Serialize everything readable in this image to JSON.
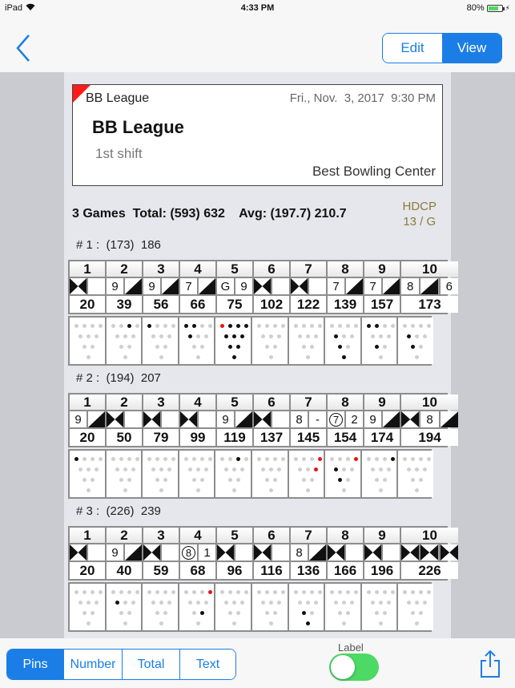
{
  "status_bar": {
    "device": "iPad",
    "time": "4:33 PM",
    "battery": "80%",
    "battery_level": 0.8
  },
  "nav": {
    "back_icon": "chevron-left-icon",
    "segments": [
      {
        "label": "Edit",
        "active": false
      },
      {
        "label": "View",
        "active": true
      }
    ]
  },
  "header": {
    "league_small": "BB League",
    "datetime": "Fri., Nov.  3, 2017  9:30 PM",
    "title": "BB League",
    "subtitle": "1st shift",
    "center": "Best Bowling Center",
    "corner_color": "#ff1a1a"
  },
  "summary": {
    "text": "3 Games  Total: (593) 632    Avg: (197.7) 210.7",
    "hdcp_label": "HDCP",
    "hdcp_value": "13 / G"
  },
  "games": [
    {
      "label": "# 1 :  (173)  186",
      "frames": [
        {
          "num": "1",
          "balls": [
            "X",
            ""
          ],
          "total": "20",
          "pins": {}
        },
        {
          "num": "2",
          "balls": [
            "9",
            "/"
          ],
          "total": "39",
          "pins": {
            "9": "black"
          }
        },
        {
          "num": "3",
          "balls": [
            "9",
            "/"
          ],
          "total": "56",
          "pins": {
            "7": "black"
          }
        },
        {
          "num": "4",
          "balls": [
            "7",
            "/"
          ],
          "total": "66",
          "pins": {
            "7": "black",
            "8": "black",
            "4": "black"
          }
        },
        {
          "num": "5",
          "balls": [
            "G",
            "9"
          ],
          "total": "75",
          "pins": {
            "7": "red",
            "8": "black",
            "9": "black",
            "10": "black",
            "4": "black",
            "5": "black",
            "6": "black",
            "2": "black",
            "3": "black",
            "1": "black"
          }
        },
        {
          "num": "6",
          "balls": [
            "X",
            ""
          ],
          "total": "102",
          "pins": {}
        },
        {
          "num": "7",
          "balls": [
            "X",
            ""
          ],
          "total": "122",
          "pins": {}
        },
        {
          "num": "8",
          "balls": [
            "7",
            "/"
          ],
          "total": "139",
          "pins": {
            "4": "black",
            "2": "black",
            "1": "black"
          }
        },
        {
          "num": "9",
          "balls": [
            "7",
            "/"
          ],
          "total": "157",
          "pins": {
            "7": "black",
            "8": "black",
            "2": "black"
          }
        },
        {
          "num": "10",
          "balls": [
            "8",
            "/",
            "6"
          ],
          "total": "173",
          "pins": {
            "4": "black",
            "2": "black"
          }
        }
      ]
    },
    {
      "label": "# 2 :  (194)  207",
      "frames": [
        {
          "num": "1",
          "balls": [
            "9",
            "/"
          ],
          "total": "20",
          "pins": {
            "7": "black"
          }
        },
        {
          "num": "2",
          "balls": [
            "X",
            ""
          ],
          "total": "50",
          "pins": {}
        },
        {
          "num": "3",
          "balls": [
            "X",
            ""
          ],
          "total": "79",
          "pins": {}
        },
        {
          "num": "4",
          "balls": [
            "X",
            ""
          ],
          "total": "99",
          "pins": {}
        },
        {
          "num": "5",
          "balls": [
            "9",
            "/"
          ],
          "total": "119",
          "pins": {
            "9": "black"
          }
        },
        {
          "num": "6",
          "balls": [
            "X",
            ""
          ],
          "total": "137",
          "pins": {}
        },
        {
          "num": "7",
          "balls": [
            "8",
            "-"
          ],
          "total": "145",
          "pins": {
            "10": "red",
            "6": "red"
          }
        },
        {
          "num": "8",
          "balls": [
            "⑦",
            "2"
          ],
          "total": "154",
          "pins": {
            "10": "red",
            "4": "black",
            "2": "black"
          }
        },
        {
          "num": "9",
          "balls": [
            "9",
            "/"
          ],
          "total": "174",
          "pins": {
            "10": "black"
          }
        },
        {
          "num": "10",
          "balls": [
            "X",
            "8",
            "/"
          ],
          "total": "194",
          "pins": {}
        }
      ]
    },
    {
      "label": "# 3 :  (226)  239",
      "frames": [
        {
          "num": "1",
          "balls": [
            "X",
            ""
          ],
          "total": "20",
          "pins": {}
        },
        {
          "num": "2",
          "balls": [
            "9",
            "/"
          ],
          "total": "40",
          "pins": {
            "4": "black"
          }
        },
        {
          "num": "3",
          "balls": [
            "X",
            ""
          ],
          "total": "59",
          "pins": {}
        },
        {
          "num": "4",
          "balls": [
            "⑧",
            "1"
          ],
          "total": "68",
          "pins": {
            "10": "red",
            "3": "black"
          }
        },
        {
          "num": "5",
          "balls": [
            "X",
            ""
          ],
          "total": "96",
          "pins": {}
        },
        {
          "num": "6",
          "balls": [
            "X",
            ""
          ],
          "total": "116",
          "pins": {}
        },
        {
          "num": "7",
          "balls": [
            "8",
            "/"
          ],
          "total": "136",
          "pins": {
            "2": "black",
            "1": "black"
          }
        },
        {
          "num": "8",
          "balls": [
            "X",
            ""
          ],
          "total": "166",
          "pins": {}
        },
        {
          "num": "9",
          "balls": [
            "X",
            ""
          ],
          "total": "196",
          "pins": {}
        },
        {
          "num": "10",
          "balls": [
            "X",
            "X",
            "X"
          ],
          "total": "226",
          "pins": {}
        }
      ]
    }
  ],
  "bottom": {
    "segments": [
      {
        "label": "Pins",
        "active": true
      },
      {
        "label": "Number",
        "active": false
      },
      {
        "label": "Total",
        "active": false
      },
      {
        "label": "Text",
        "active": false
      }
    ],
    "toggle_label": "Label",
    "toggle_on": true,
    "share_icon": "share-icon",
    "accent": "#1a7ee6",
    "toggle_color": "#4cd964"
  }
}
